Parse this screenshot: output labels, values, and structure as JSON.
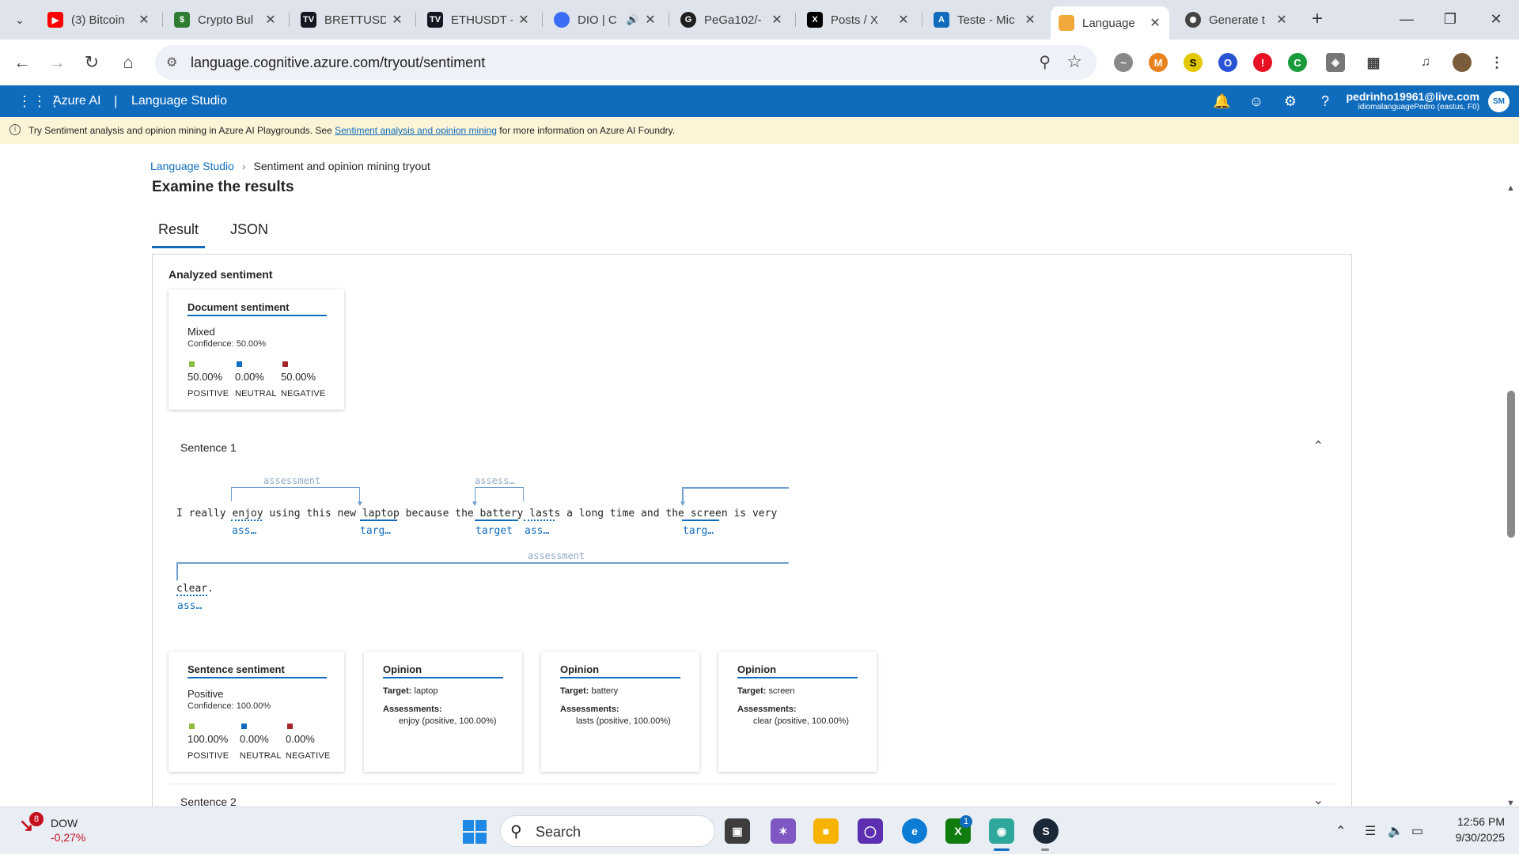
{
  "browser": {
    "tabs": [
      {
        "title": "(3) Bitcoin",
        "icon": "youtube-icon",
        "color": "#ff0000"
      },
      {
        "title": "Crypto Bul",
        "icon": "crypto-icon",
        "color": "#2e7d32"
      },
      {
        "title": "BRETTUSD",
        "icon": "tradingview-icon",
        "color": "#131722"
      },
      {
        "title": "ETHUSDT -",
        "icon": "tradingview-icon",
        "color": "#131722"
      },
      {
        "title": "DIO | C",
        "icon": "dio-icon",
        "color": "#3b6cf6"
      },
      {
        "title": "PeGa102/-",
        "icon": "github-icon",
        "color": "#1f1f1f"
      },
      {
        "title": "Posts / X",
        "icon": "x-icon",
        "color": "#000000"
      },
      {
        "title": "Teste - Mic",
        "icon": "azure-icon",
        "color": "#0f6cbd"
      },
      {
        "title": "Language",
        "icon": "language-studio-icon",
        "color": "#f2a93b"
      },
      {
        "title": "Generate t",
        "icon": "openai-icon",
        "color": "#444444"
      }
    ],
    "url": "language.cognitive.azure.com/tryout/sentiment"
  },
  "azure": {
    "brand": "Azure AI",
    "separator": "|",
    "studio": "Language Studio",
    "account_email": "pedrinho19961@live.com",
    "account_resource": "idiomalanguagePedro (eastus, F0)",
    "avatar_initials": "SM"
  },
  "banner": {
    "before": "Try Sentiment analysis and opinion mining in Azure AI Playgrounds. See ",
    "link": "Sentiment analysis and opinion mining",
    "after": " for more information on Azure AI Foundry."
  },
  "page": {
    "breadcrumb_root": "Language Studio",
    "breadcrumb_current": "Sentiment and opinion mining tryout",
    "title": "Examine the results",
    "tabs": [
      "Result",
      "JSON"
    ],
    "analyzed_label": "Analyzed sentiment"
  },
  "document_sentiment": {
    "header": "Document sentiment",
    "value": "Mixed",
    "confidence": "Confidence: 50.00%",
    "scores": [
      {
        "value": "50.00%",
        "label": "POSITIVE",
        "color": "#8cbd3f"
      },
      {
        "value": "0.00%",
        "label": "NEUTRAL",
        "color": "#0f6cbd"
      },
      {
        "value": "50.00%",
        "label": "NEGATIVE",
        "color": "#a4262c"
      }
    ]
  },
  "sentence1": {
    "label": "Sentence 1",
    "words": {
      "w1": "I really ",
      "enjoy": "enjoy",
      "w2": " using this new ",
      "laptop": "laptop",
      "w3": " because the ",
      "battery": "battery",
      "sp": " ",
      "lasts": "lasts",
      "w4": " a long time and the ",
      "screen": "screen",
      "w5": " is very",
      "clear": "clear",
      "period": "."
    },
    "tags": {
      "enjoy": "ass…",
      "laptop": "targ…",
      "battery": "target",
      "lasts": "ass…",
      "screen": "targ…",
      "clear": "ass…"
    },
    "relations": {
      "r1": "assessment",
      "r2": "assess…",
      "r3": "assessment"
    },
    "sentence_sentiment": {
      "header": "Sentence sentiment",
      "value": "Positive",
      "confidence": "Confidence: 100.00%",
      "scores": [
        {
          "value": "100.00%",
          "label": "POSITIVE",
          "color": "#8cbd3f"
        },
        {
          "value": "0.00%",
          "label": "NEUTRAL",
          "color": "#0f6cbd"
        },
        {
          "value": "0.00%",
          "label": "NEGATIVE",
          "color": "#a4262c"
        }
      ]
    },
    "opinions": [
      {
        "header": "Opinion",
        "target_label": "Target:",
        "target": " laptop",
        "assess_label": "Assessments:",
        "assessment": "enjoy (positive, 100.00%)"
      },
      {
        "header": "Opinion",
        "target_label": "Target:",
        "target": " battery",
        "assess_label": "Assessments:",
        "assessment": "lasts (positive, 100.00%)"
      },
      {
        "header": "Opinion",
        "target_label": "Target:",
        "target": " screen",
        "assess_label": "Assessments:",
        "assessment": "clear (positive, 100.00%)"
      }
    ]
  },
  "sentence2": {
    "label": "Sentence 2"
  },
  "taskbar": {
    "widget_badge": "8",
    "widget_name": "DOW",
    "widget_value": "-0,27%",
    "search": "Search",
    "xbox_badge": "1",
    "time": "12:56 PM",
    "date": "9/30/2025"
  }
}
